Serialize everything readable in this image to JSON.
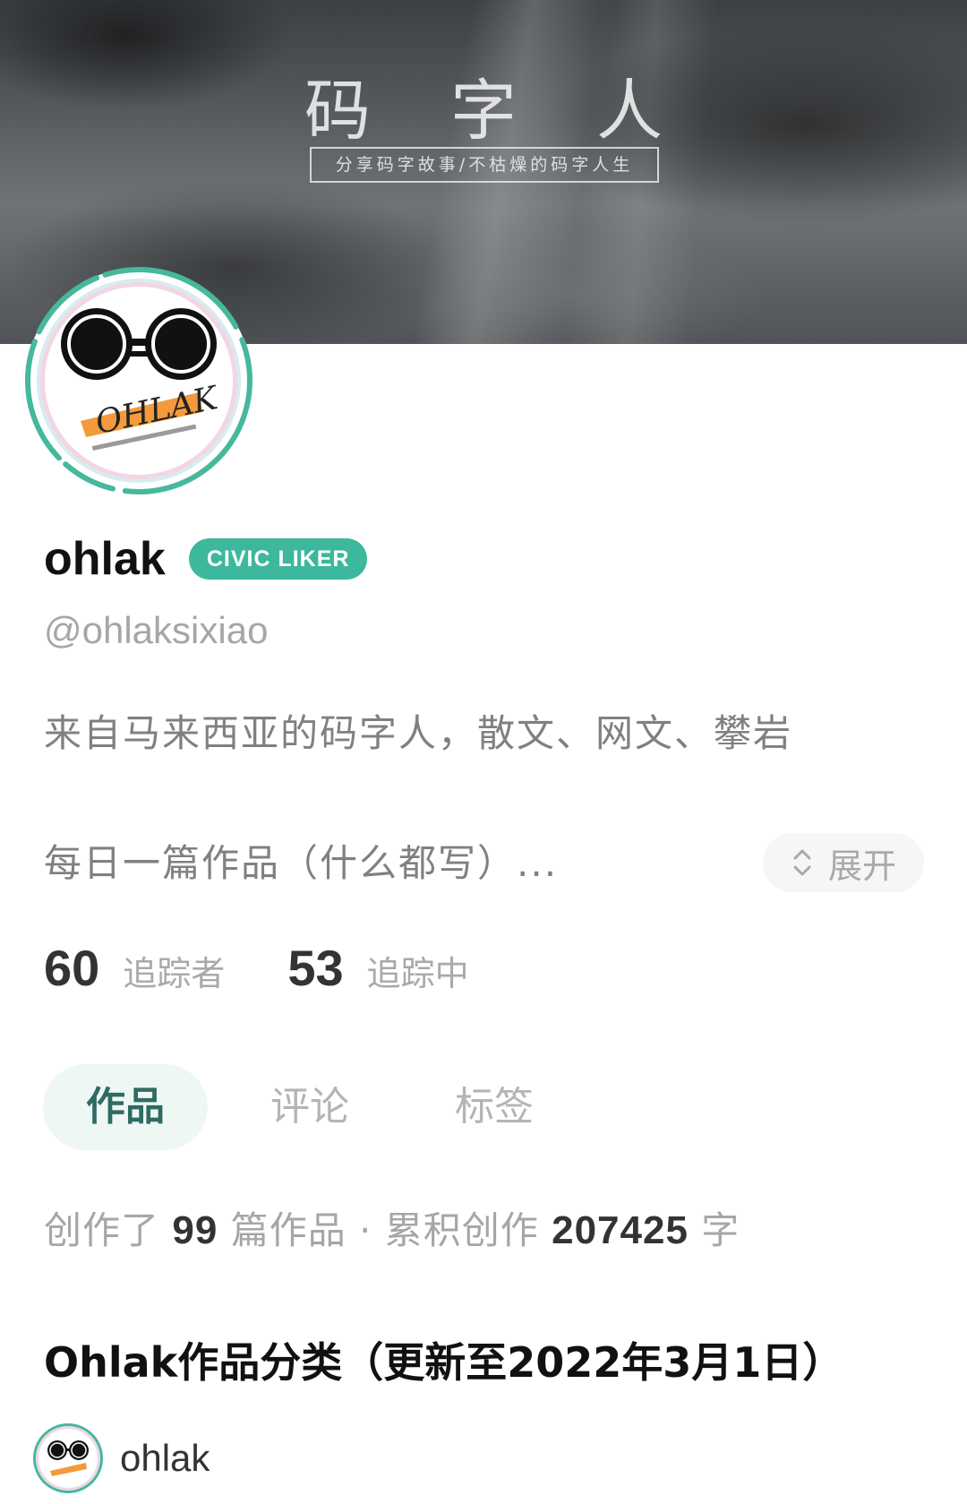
{
  "cover": {
    "title_chars": [
      "码",
      "字",
      "人"
    ],
    "subtitle": "分享码字故事/不枯燥的码字人生"
  },
  "profile": {
    "name": "ohlak",
    "badge": "CIVIC LIKER",
    "handle": "@ohlaksixiao",
    "bio": "来自马来西亚的码字人，散文、网文、攀岩",
    "description": "每日一篇作品（什么都写）...",
    "expand_label": "展开",
    "avatar_logo_text": "OHLAK"
  },
  "stats": [
    {
      "value": "60",
      "label": "追踪者"
    },
    {
      "value": "53",
      "label": "追踪中"
    }
  ],
  "tabs": [
    {
      "label": "作品",
      "active": true
    },
    {
      "label": "评论",
      "active": false
    },
    {
      "label": "标签",
      "active": false
    }
  ],
  "summary": {
    "prefix": "创作了",
    "works_count": "99",
    "middle": "篇作品 · 累积创作",
    "word_count": "207425",
    "suffix": "字"
  },
  "post": {
    "title": "Ohlak作品分类（更新至2022年3月1日）",
    "author": "ohlak"
  },
  "colors": {
    "accent": "#3eb89c",
    "active_tab_bg": "#eef7f4",
    "active_tab_text": "#2f6b62",
    "muted_text": "#a6a6a6"
  }
}
